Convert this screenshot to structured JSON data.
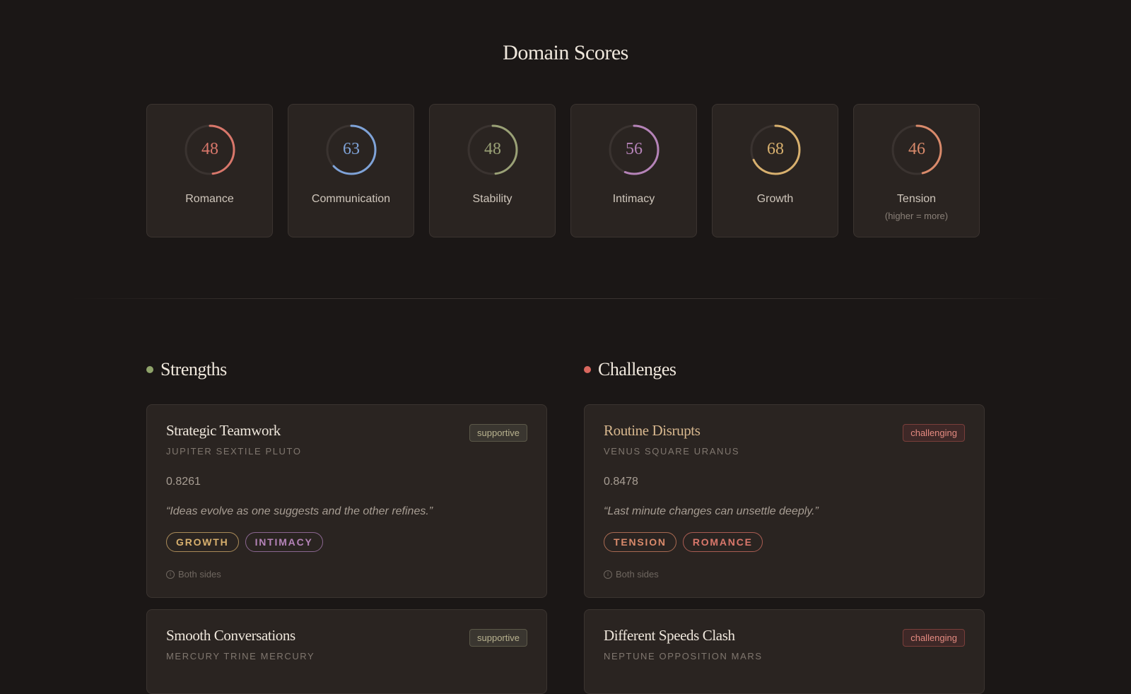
{
  "domain_scores": {
    "title": "Domain Scores",
    "items": [
      {
        "label": "Romance",
        "value": 48,
        "color": "#d9776b",
        "sub": ""
      },
      {
        "label": "Communication",
        "value": 63,
        "color": "#7fa3d8",
        "sub": ""
      },
      {
        "label": "Stability",
        "value": 48,
        "color": "#9aa176",
        "sub": ""
      },
      {
        "label": "Intimacy",
        "value": 56,
        "color": "#b583b8",
        "sub": ""
      },
      {
        "label": "Growth",
        "value": 68,
        "color": "#d8b06e",
        "sub": ""
      },
      {
        "label": "Tension",
        "value": 46,
        "color": "#d98a6b",
        "sub": "(higher = more)"
      }
    ]
  },
  "strengths": {
    "title": "Strengths",
    "dot_color": "#8fa36a",
    "cards": [
      {
        "title": "Strategic Teamwork",
        "aspect": "JUPITER SEXTILE PLUTO",
        "badge": "supportive",
        "score": "0.8261",
        "quote": "“Ideas evolve as one suggests and the other refines.”",
        "tags": [
          {
            "label": "GROWTH",
            "color": "#d8b06e"
          },
          {
            "label": "INTIMACY",
            "color": "#b583b8"
          }
        ],
        "foot": "Both sides"
      },
      {
        "title": "Smooth Conversations",
        "aspect": "MERCURY TRINE MERCURY",
        "badge": "supportive"
      }
    ]
  },
  "challenges": {
    "title": "Challenges",
    "dot_color": "#d9675e",
    "cards": [
      {
        "title": "Routine Disrupts",
        "aspect": "VENUS SQUARE URANUS",
        "badge": "challenging",
        "score": "0.8478",
        "quote": "“Last minute changes can unsettle deeply.”",
        "tags": [
          {
            "label": "TENSION",
            "color": "#d98a6b"
          },
          {
            "label": "ROMANCE",
            "color": "#d9776b"
          }
        ],
        "foot": "Both sides"
      },
      {
        "title": "Different Speeds Clash",
        "aspect": "NEPTUNE OPPOSITION MARS",
        "badge": "challenging"
      }
    ]
  }
}
